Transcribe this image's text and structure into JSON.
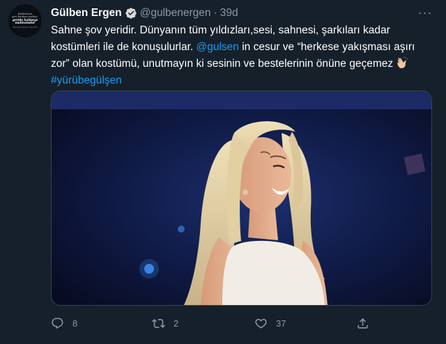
{
  "tweet": {
    "avatar_text": {
      "line1": "Kadınlarını",
      "line2": "geri bırakan toplum,",
      "line3": "geride kalmaya",
      "line4": "mahkumdur",
      "attribution": "Mustafa Kemal Atatürk"
    },
    "author_name": "Gülben Ergen",
    "handle": "@gulbenergen",
    "separator": "·",
    "time": "39d",
    "more_label": "···",
    "text": {
      "line1": "Sahne şov yeridir. Dünyanın tüm yıldızları,sesi, sahnesi, şarkıları kadar",
      "line2_a": "kostümleri ile de konuşulurlar. ",
      "mention": "@gulsen",
      "line2_b": " in cesur ve “herkese yakışması aşırı",
      "line3": "zor” olan kostümü, unutmayın ki sesinin ve bestelerinin önüne geçemez",
      "hashtag": "#yürübegülşen"
    },
    "emoji": "clapping-hands-icon",
    "media": {
      "description_icon": "photo"
    },
    "actions": {
      "replies": "8",
      "retweets": "2",
      "likes": "37"
    },
    "colors": {
      "background": "#15202b",
      "link": "#1d9bf0",
      "secondary_text": "#8b98a5",
      "border": "#38444d",
      "verified": "#d9d9d9"
    }
  }
}
